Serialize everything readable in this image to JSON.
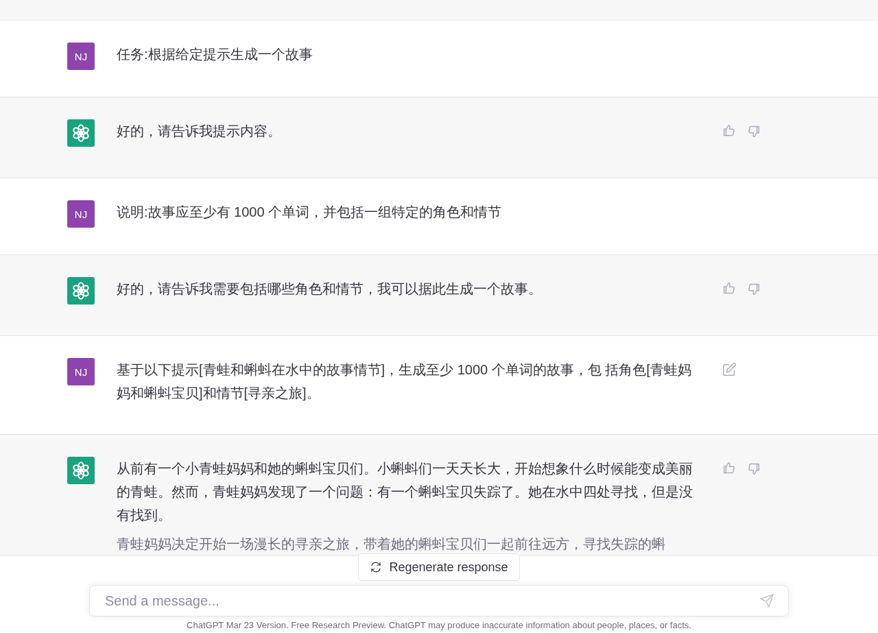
{
  "messages": [
    {
      "kind": "user",
      "avatar": "NJ",
      "paragraphs": [
        "任务:根据给定提示生成一个故事"
      ],
      "edit_visible": false
    },
    {
      "kind": "assistant",
      "paragraphs": [
        "好的，请告诉我提示内容。"
      ]
    },
    {
      "kind": "user",
      "avatar": "NJ",
      "paragraphs": [
        "说明:故事应至少有 1000 个单词，并包括一组特定的角色和情节"
      ],
      "edit_visible": false
    },
    {
      "kind": "assistant",
      "paragraphs": [
        "好的，请告诉我需要包括哪些角色和情节，我可以据此生成一个故事。"
      ]
    },
    {
      "kind": "user",
      "avatar": "NJ",
      "paragraphs": [
        "基于以下提示[青蛙和蝌蚪在水中的故事情节]，生成至少 1000 个单词的故事，包 括角色[青蛙妈妈和蝌蚪宝贝]和情节[寻亲之旅]。"
      ],
      "edit_visible": true
    },
    {
      "kind": "assistant",
      "paragraphs": [
        "从前有一个小青蛙妈妈和她的蝌蚪宝贝们。小蝌蚪们一天天长大，开始想象什么时候能变成美丽的青蛙。然而，青蛙妈妈发现了一个问题：有一个蝌蚪宝贝失踪了。她在水中四处寻找，但是没有找到。",
        "青蛙妈妈决定开始一场漫长的寻亲之旅，带着她的蝌蚪宝贝们一起前往远方，寻找失踪的蝌"
      ]
    }
  ],
  "regenerate_button": "Regenerate response",
  "composer": {
    "placeholder": "Send a message..."
  },
  "footer": "ChatGPT Mar 23 Version. Free Research Preview. ChatGPT may produce inaccurate information about people, places, or facts."
}
